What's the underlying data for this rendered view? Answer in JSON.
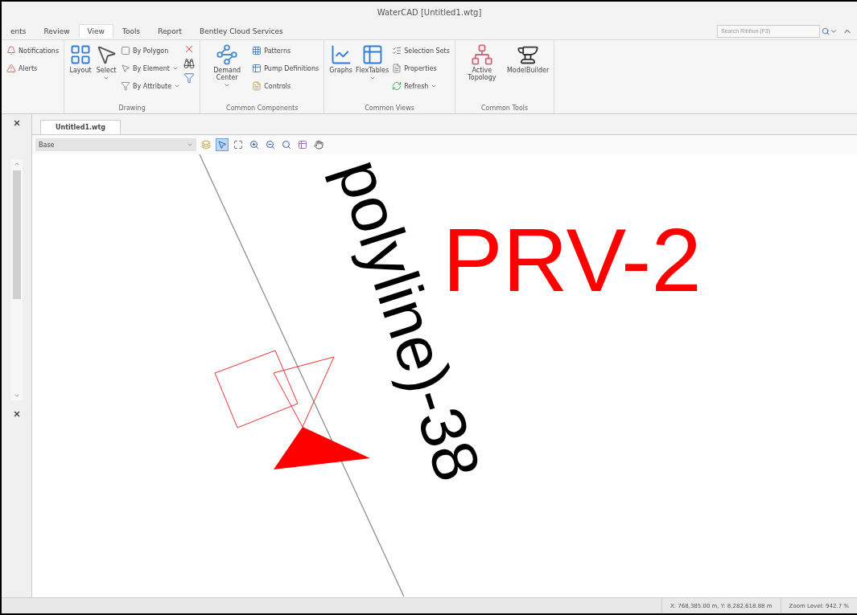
{
  "window": {
    "title": "WaterCAD [Untitled1.wtg]"
  },
  "ribbon_tabs": [
    {
      "label": "ents",
      "selected": false
    },
    {
      "label": "Review",
      "selected": false
    },
    {
      "label": "View",
      "selected": true
    },
    {
      "label": "Tools",
      "selected": false
    },
    {
      "label": "Report",
      "selected": false
    },
    {
      "label": "Bentley Cloud Services",
      "selected": false
    }
  ],
  "search": {
    "placeholder": "Search Ribbon (F3)"
  },
  "ribbon_groups": [
    {
      "items": [
        {
          "kind": "small",
          "label": "Notifications",
          "dropdown": false
        },
        {
          "kind": "small",
          "label": "Alerts",
          "dropdown": false
        }
      ]
    },
    {
      "label": "Drawing",
      "items": [
        {
          "kind": "large",
          "label": "Layout",
          "dropdown": false
        },
        {
          "kind": "large",
          "label": "Select",
          "dropdown": true
        },
        {
          "kind": "small",
          "label": "By Polygon",
          "dropdown": false
        },
        {
          "kind": "small",
          "label": "By Element",
          "dropdown": true
        },
        {
          "kind": "small",
          "label": "By Attribute",
          "dropdown": true
        },
        {
          "kind": "icons"
        }
      ]
    },
    {
      "label": "Common Components",
      "items": [
        {
          "kind": "large",
          "label": "Demand Center",
          "dropdown": true
        },
        {
          "kind": "small",
          "label": "Patterns",
          "dropdown": false
        },
        {
          "kind": "small",
          "label": "Pump Definitions",
          "dropdown": false
        },
        {
          "kind": "small",
          "label": "Controls",
          "dropdown": false
        }
      ]
    },
    {
      "label": "Common Views",
      "items": [
        {
          "kind": "large",
          "label": "Graphs",
          "dropdown": false
        },
        {
          "kind": "large",
          "label": "FlexTables",
          "dropdown": true
        },
        {
          "kind": "small",
          "label": "Selection Sets",
          "dropdown": false
        },
        {
          "kind": "small",
          "label": "Properties",
          "dropdown": false
        },
        {
          "kind": "small",
          "label": "Refresh",
          "dropdown": true
        }
      ]
    },
    {
      "label": "Common Tools",
      "items": [
        {
          "kind": "large",
          "label": "Active Topology",
          "dropdown": false
        },
        {
          "kind": "large",
          "label": "ModelBuilder",
          "dropdown": false
        }
      ]
    }
  ],
  "document_tab": {
    "label": "Untitled1.wtg",
    "selected": true
  },
  "toolbar": {
    "layer_select": "Base"
  },
  "canvas": {
    "element_label": "PRV-2",
    "pipe_label": "polyline)-38"
  },
  "status_bar": {
    "coordinates": "X: 768,385.00 m, Y: 8,282,618.88 m",
    "zoom": "Zoom Level: 942.7 %"
  }
}
